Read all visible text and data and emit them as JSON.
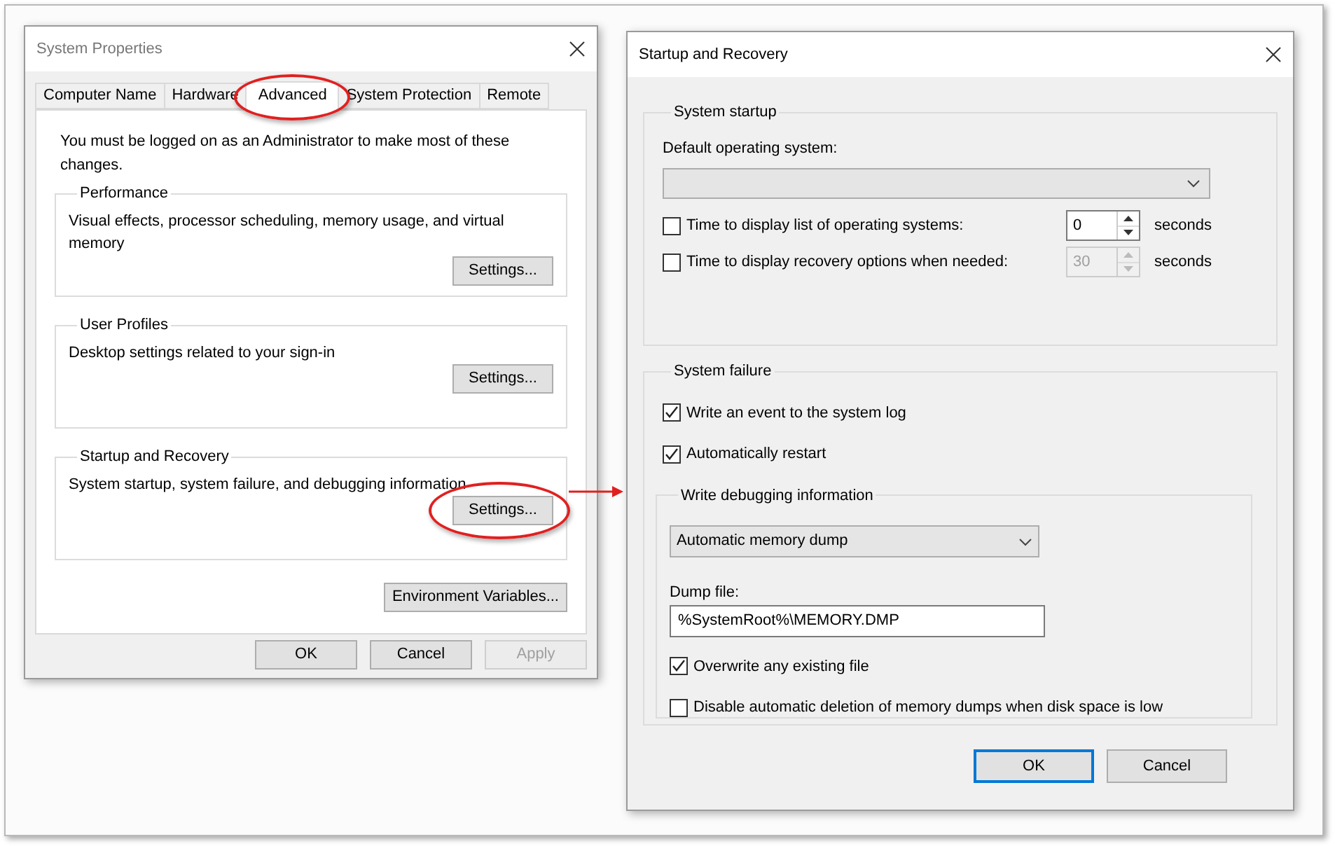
{
  "system_properties": {
    "title": "System Properties",
    "tabs": [
      {
        "label": "Computer Name",
        "selected": false,
        "circled": false
      },
      {
        "label": "Hardware",
        "selected": false,
        "circled": false
      },
      {
        "label": "Advanced",
        "selected": true,
        "circled": true
      },
      {
        "label": "System Protection",
        "selected": false,
        "circled": false
      },
      {
        "label": "Remote",
        "selected": false,
        "circled": false
      }
    ],
    "notice": "You must be logged on as an Administrator to make most of these changes.",
    "groups": [
      {
        "title": "Performance",
        "description": "Visual effects, processor scheduling, memory usage, and virtual memory",
        "button": {
          "label": "Settings...",
          "circled": false
        }
      },
      {
        "title": "User Profiles",
        "description": "Desktop settings related to your sign-in",
        "button": {
          "label": "Settings...",
          "circled": false
        }
      },
      {
        "title": "Startup and Recovery",
        "description": "System startup, system failure, and debugging information",
        "button": {
          "label": "Settings...",
          "circled": true
        }
      }
    ],
    "environment_button": "Environment Variables...",
    "buttons": [
      {
        "label": "OK",
        "disabled": false
      },
      {
        "label": "Cancel",
        "disabled": false
      },
      {
        "label": "Apply",
        "disabled": true
      }
    ]
  },
  "startup_and_recovery": {
    "title": "Startup and Recovery",
    "system_startup": {
      "title": "System startup",
      "default_os_label": "Default operating system:",
      "timeouts": [
        {
          "label": "Time to display list of operating systems:",
          "checked": false,
          "value": "0",
          "disabled": false,
          "unit": "seconds"
        },
        {
          "label": "Time to display recovery options when needed:",
          "checked": false,
          "value": "30",
          "disabled": true,
          "unit": "seconds"
        }
      ]
    },
    "system_failure": {
      "title": "System failure",
      "options": [
        {
          "label": "Write an event to the system log",
          "checked": true
        },
        {
          "label": "Automatically restart",
          "checked": true
        }
      ],
      "debugging": {
        "title": "Write debugging information",
        "dump_type": "Automatic memory dump",
        "dump_file_label": "Dump file:",
        "dump_file": "%SystemRoot%\\MEMORY.DMP",
        "options": [
          {
            "label": "Overwrite any existing file",
            "checked": true
          },
          {
            "label": "Disable automatic deletion of memory dumps when disk space is low",
            "checked": false
          }
        ]
      }
    },
    "buttons": [
      {
        "label": "OK",
        "default": true
      },
      {
        "label": "Cancel",
        "default": false
      }
    ]
  }
}
